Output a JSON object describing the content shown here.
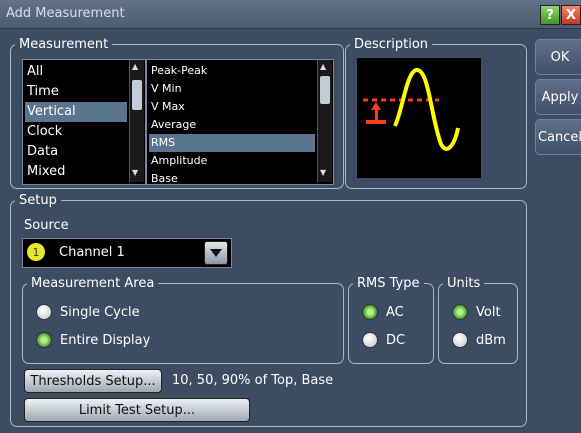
{
  "window": {
    "title": "Add Measurement",
    "help_label": "?",
    "close_label": "X"
  },
  "measurement": {
    "legend": "Measurement",
    "categories": [
      "All",
      "Time",
      "Vertical",
      "Clock",
      "Data",
      "Mixed"
    ],
    "selected_category": "Vertical",
    "types": [
      "Peak-Peak",
      "V Min",
      "V Max",
      "Average",
      "RMS",
      "Amplitude",
      "Base"
    ],
    "selected_type": "RMS"
  },
  "description": {
    "legend": "Description"
  },
  "buttons": {
    "ok": "OK",
    "apply": "Apply",
    "cancel": "Cancel"
  },
  "setup": {
    "legend": "Setup",
    "source_label": "Source",
    "source_badge": "1",
    "source_value": "Channel 1",
    "area_legend": "Measurement Area",
    "area_options": [
      "Single Cycle",
      "Entire Display"
    ],
    "area_selected": "Entire Display",
    "rms_legend": "RMS Type",
    "rms_options": [
      "AC",
      "DC"
    ],
    "rms_selected": "AC",
    "units_legend": "Units",
    "units_options": [
      "Volt",
      "dBm"
    ],
    "units_selected": "Volt",
    "thresholds_button": "Thresholds Setup...",
    "thresholds_text": "10, 50, 90% of Top, Base",
    "limit_button": "Limit Test Setup..."
  },
  "colors": {
    "selection": "#5b7591",
    "waveform": "#ffff00",
    "marker": "#ff3b1f",
    "source_badge": "#e6e62a"
  }
}
